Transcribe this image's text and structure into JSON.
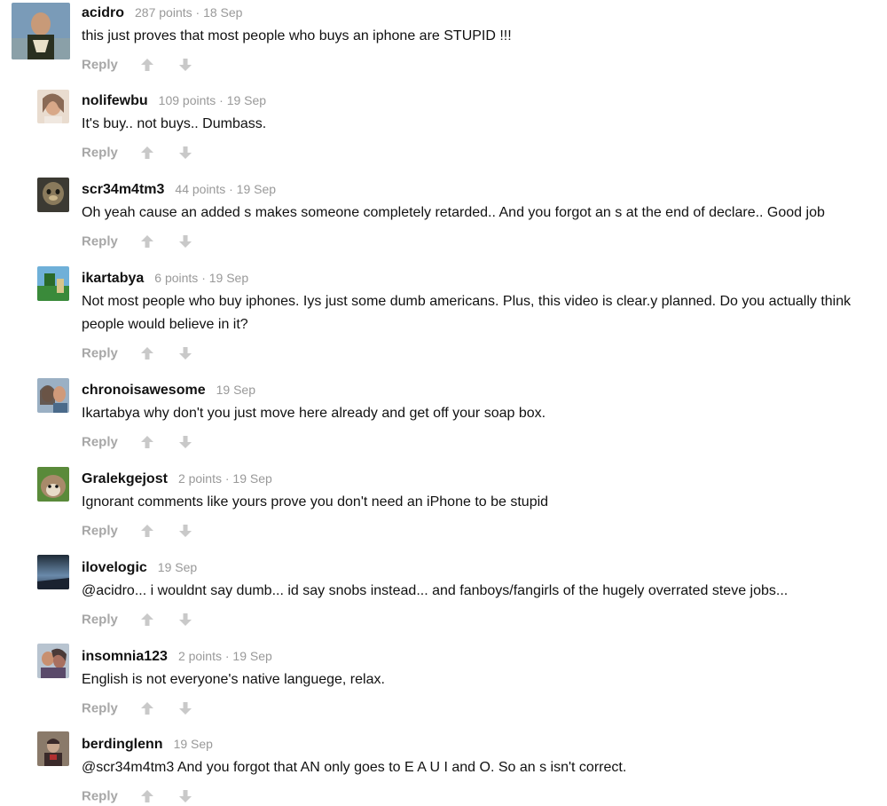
{
  "comments": [
    {
      "author": "acidro",
      "info": "287 points · 18 Sep",
      "text": "this just proves that most people who buys an iphone are STUPID !!!",
      "reply": "Reply",
      "avatar_colors": [
        "#7a9bb8",
        "#3a4a2a",
        "#c8b89a"
      ]
    },
    {
      "author": "nolifewbu",
      "info": "109 points · 19 Sep",
      "text": "It's buy.. not buys.. Dumbass.",
      "reply": "Reply",
      "avatar_colors": [
        "#e9dccf",
        "#b58a6a",
        "#8a6a55"
      ]
    },
    {
      "author": "scr34m4tm3",
      "info": "44 points · 19 Sep",
      "text": "Oh yeah cause an added s makes someone completely retarded.. And you forgot an s at the end of declare.. Good job",
      "reply": "Reply",
      "avatar_colors": [
        "#3c3a33",
        "#8a7a5c",
        "#c9b58a"
      ]
    },
    {
      "author": "ikartabya",
      "info": "6 points · 19 Sep",
      "text": "Not most people who buy iphones. Iys just some dumb americans. Plus, this video is clear.y planned. Do you actually think people would believe in it?",
      "reply": "Reply",
      "avatar_colors": [
        "#6fb0d8",
        "#3a8a3a",
        "#d8c58a"
      ]
    },
    {
      "author": "chronoisawesome",
      "info": "19 Sep",
      "text": "Ikartabya why don't you just move here already and get off your soap box.",
      "reply": "Reply",
      "avatar_colors": [
        "#9bb0c4",
        "#c48a6a",
        "#5a4a40"
      ]
    },
    {
      "author": "Gralekgejost",
      "info": "2 points · 19 Sep",
      "text": "Ignorant comments like yours prove you don't need an iPhone to be stupid",
      "reply": "Reply",
      "avatar_colors": [
        "#5a8a3a",
        "#a88a6a",
        "#e8dcc8"
      ]
    },
    {
      "author": "ilovelogic",
      "info": "19 Sep",
      "text": "@acidro... i wouldnt say dumb... id say snobs instead... and fanboys/fangirls of the hugely overrated steve jobs...",
      "reply": "Reply",
      "avatar_colors": [
        "#2e3c4e",
        "#6a8aaa",
        "#1e2a36"
      ]
    },
    {
      "author": "insomnia123",
      "info": "2 points · 19 Sep",
      "text": "English is not everyone's native languege, relax.",
      "reply": "Reply",
      "avatar_colors": [
        "#b8c4d0",
        "#a87060",
        "#4a3a38"
      ]
    },
    {
      "author": "berdinglenn",
      "info": "19 Sep",
      "text": "@scr34m4tm3 And you forgot that AN only goes to E A U I and O. So an s isn't correct.",
      "reply": "Reply",
      "avatar_colors": [
        "#8a7a6a",
        "#3a2a2a",
        "#c8a890"
      ]
    }
  ]
}
